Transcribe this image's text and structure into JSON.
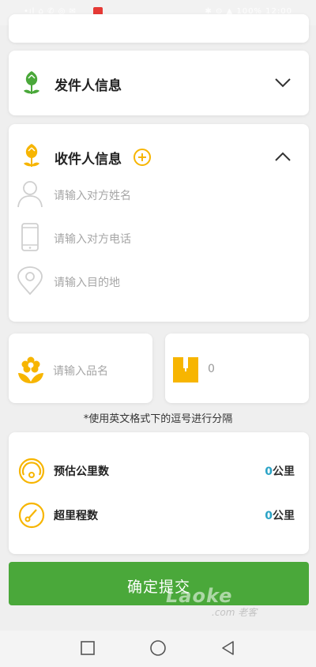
{
  "status_bar": {
    "left_text": "•ıl ⌂ ✆ ◎ ✉",
    "right_text": "✱ ⊙ ▲ 100% 12:00"
  },
  "sender": {
    "title": "发件人信息",
    "icon": "tulip-icon",
    "state": "collapsed"
  },
  "recipient": {
    "title": "收件人信息",
    "icon": "tulip-icon",
    "state": "expanded",
    "fields": [
      {
        "icon": "person-icon",
        "placeholder": "请输入对方姓名"
      },
      {
        "icon": "phone-icon",
        "placeholder": "请输入对方电话"
      },
      {
        "icon": "location-pin-icon",
        "placeholder": "请输入目的地"
      }
    ]
  },
  "item": {
    "icon": "flower-icon",
    "placeholder": "请输入品名"
  },
  "quantity": {
    "icon": "box-icon",
    "value": "0"
  },
  "hint_text": "*使用英文格式下的逗号进行分隔",
  "distance": {
    "rows": [
      {
        "label": "预估公里数",
        "value": "0",
        "unit": "公里",
        "icon": "gauge-icon"
      },
      {
        "label": "超里程数",
        "value": "0",
        "unit": "公里",
        "icon": "speedometer-icon"
      }
    ]
  },
  "submit_label": "确定提交",
  "watermark": {
    "main": "Laoke",
    "sub": ".com 老客"
  },
  "colors": {
    "accent_green": "#4aa83a",
    "accent_orange": "#f7b500",
    "value_blue": "#2aa3c6"
  }
}
